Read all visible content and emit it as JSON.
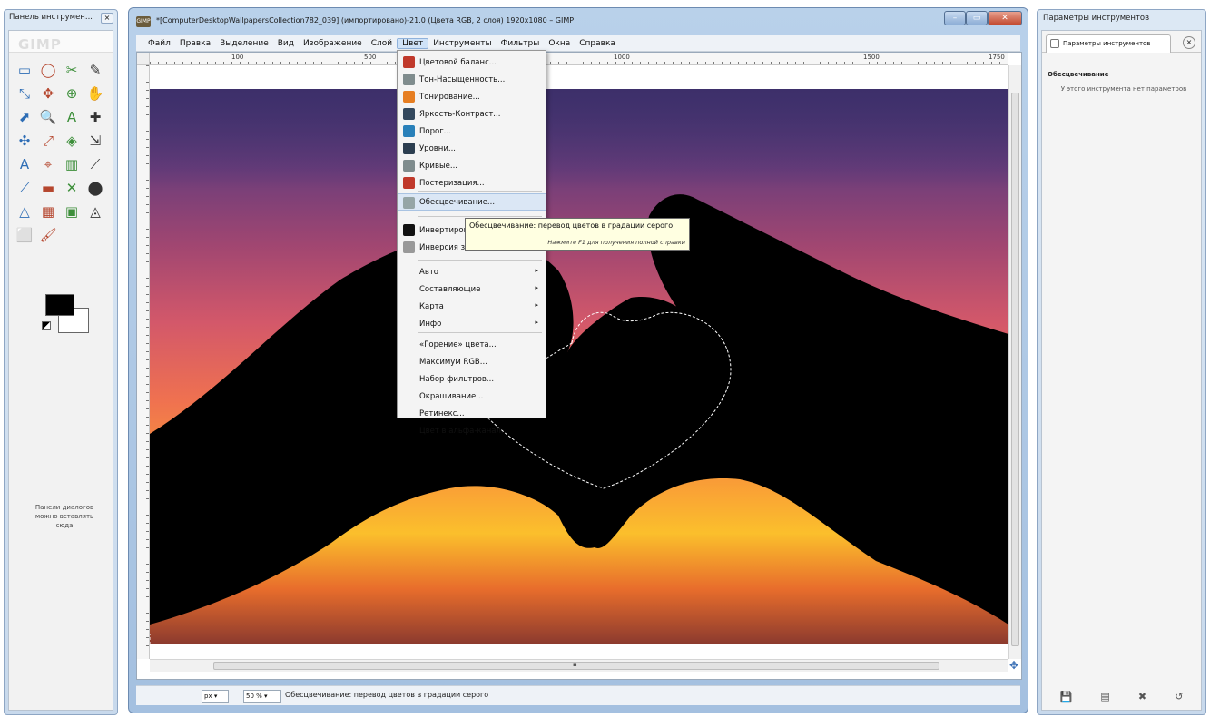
{
  "toolbox": {
    "title": "Панель инструмен...",
    "logo_text": "GIMP",
    "tools": [
      "▭",
      "◯",
      "✂",
      "✎",
      "⤡",
      "✥",
      "⊕",
      "✋",
      "⬈",
      "🔍",
      "A",
      "✚",
      "✣",
      "⤢",
      "◈",
      "⇲",
      "A",
      "⌖",
      "▥",
      "⟋",
      "⟋",
      "▬",
      "✕",
      "⬤",
      "△",
      "▦",
      "▣",
      "◬",
      "⬜",
      "🖌"
    ],
    "hint": "Панели диалогов можно вставлять сюда"
  },
  "window": {
    "title": "*[ComputerDesktopWallpapersCollection782_039] (импортировано)-21.0 (Цвета RGB, 2 слоя) 1920x1080 – GIMP",
    "app_icon": "wilber-icon"
  },
  "menubar": {
    "items": [
      "Файл",
      "Правка",
      "Выделение",
      "Вид",
      "Изображение",
      "Слой",
      "Цвет",
      "Инструменты",
      "Фильтры",
      "Окна",
      "Справка"
    ],
    "active_index": 6
  },
  "ruler": {
    "labels": [
      "100",
      "500",
      "1000",
      "1500",
      "1750"
    ]
  },
  "colors_menu": {
    "items": [
      {
        "label": "Цветовой баланс...",
        "icon": "color-balance-icon",
        "color": "#c0392b"
      },
      {
        "label": "Тон-Насыщенность...",
        "icon": "hue-saturation-icon",
        "color": "#7f8c8d"
      },
      {
        "label": "Тонирование...",
        "icon": "colorize-icon",
        "color": "#e67e22"
      },
      {
        "label": "Яркость-Контраст...",
        "icon": "brightness-contrast-icon",
        "color": "#34495e"
      },
      {
        "label": "Порог...",
        "icon": "threshold-icon",
        "color": "#2980b9"
      },
      {
        "label": "Уровни...",
        "icon": "levels-icon",
        "color": "#2c3e50"
      },
      {
        "label": "Кривые...",
        "icon": "curves-icon",
        "color": "#7f8c8d"
      },
      {
        "label": "Постеризация...",
        "icon": "posterize-icon",
        "color": "#c0392b"
      },
      {
        "label": "Обесцвечивание...",
        "icon": "desaturate-icon",
        "color": "#95a5a6"
      },
      {
        "label": "Инвертировать",
        "icon": "invert-icon",
        "color": "#111111"
      },
      {
        "label": "Инверсия значений",
        "icon": "value-invert-icon",
        "color": ""
      },
      {
        "label": "Авто",
        "submenu": true
      },
      {
        "label": "Составляющие",
        "submenu": true
      },
      {
        "label": "Карта",
        "submenu": true
      },
      {
        "label": "Инфо",
        "submenu": true
      },
      {
        "label": "«Горение» цвета...",
        "icon": "",
        "color": ""
      },
      {
        "label": "Максимум RGB...",
        "icon": "",
        "color": ""
      },
      {
        "label": "Набор фильтров...",
        "icon": "",
        "color": ""
      },
      {
        "label": "Окрашивание...",
        "icon": "",
        "color": ""
      },
      {
        "label": "Ретинекс...",
        "icon": "",
        "color": ""
      },
      {
        "label": "Цвет в альфа-канал...",
        "icon": "",
        "color": ""
      }
    ],
    "highlighted_index": 8
  },
  "tooltip": {
    "text": "Обесцвечивание: перевод цветов в градации серого",
    "help": "Нажмите F1 для получения полной справки"
  },
  "statusbar": {
    "unit": "px",
    "zoom": "50 %",
    "message": "Обесцвечивание: перевод цветов в градации серого"
  },
  "dock": {
    "title": "Параметры инструментов",
    "tab_label": "Параметры инструментов",
    "section_header": "Обесцвечивание",
    "message": "У этого инструмента нет параметров"
  },
  "colors": {
    "window_frame": "#a4c0e0",
    "menu_highlight": "#dbe7f5",
    "tooltip_bg": "#ffffe1"
  }
}
